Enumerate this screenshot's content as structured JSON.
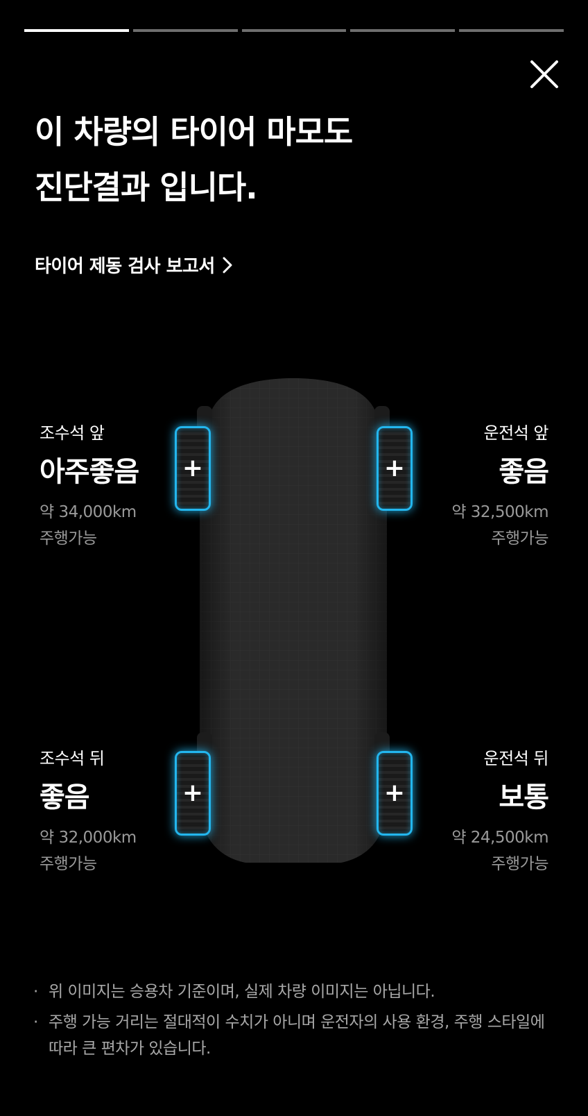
{
  "progress": {
    "total_steps": 5,
    "current_step": 1
  },
  "title": {
    "line1": "이 차량의 타이어 마모도",
    "line2": "진단결과 입니다."
  },
  "report_link": {
    "label": "타이어 제동 검사 보고서"
  },
  "tires": {
    "front_left": {
      "position": "조수석 앞",
      "status": "아주좋음",
      "distance": "약 34,000km",
      "suffix": "주행가능"
    },
    "front_right": {
      "position": "운전석 앞",
      "status": "좋음",
      "distance": "약 32,500km",
      "suffix": "주행가능"
    },
    "rear_left": {
      "position": "조수석 뒤",
      "status": "좋음",
      "distance": "약 32,000km",
      "suffix": "주행가능"
    },
    "rear_right": {
      "position": "운전석 뒤",
      "status": "보통",
      "distance": "약 24,500km",
      "suffix": "주행가능"
    }
  },
  "tire_plus": "+",
  "notes": [
    "위 이미지는 승용차 기준이며, 실제 차량 이미지는 아닙니다.",
    "주행 가능 거리는 절대적이 수치가 아니며 운전자의 사용 환경, 주행 스타일에 따라 큰 편차가 있습니다."
  ],
  "note_bullet": "·",
  "colors": {
    "accent": "#23b6ee",
    "background": "#000000",
    "muted_text": "#a8a8a8"
  }
}
